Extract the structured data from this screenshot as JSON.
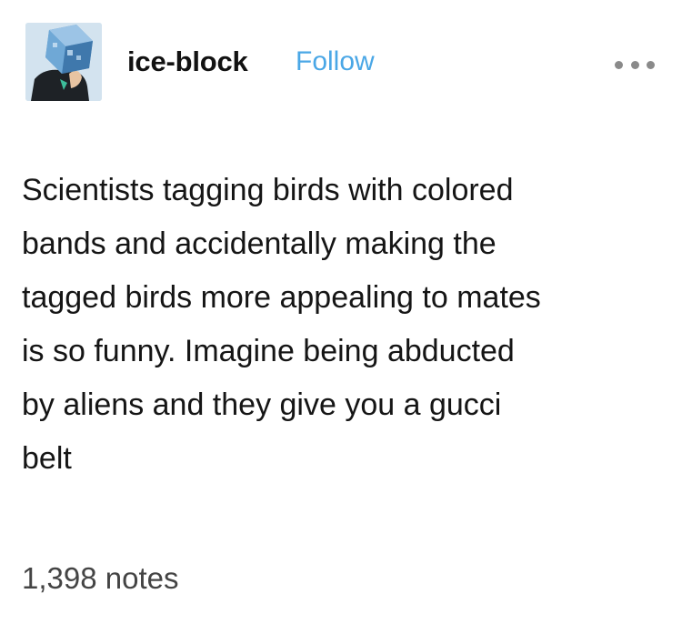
{
  "post": {
    "author": {
      "avatar_icon": "avatar-ice-block-head-icon",
      "username": "ice-block",
      "follow_label": "Follow"
    },
    "menu_icon": "more-options-icon",
    "body_lines": [
      "Scientists tagging birds with colored",
      "bands and accidentally making the",
      "tagged birds more appealing to mates",
      "is so funny. Imagine being abducted",
      "by aliens and they give you a gucci",
      "belt"
    ],
    "notes": "1,398 notes"
  },
  "colors": {
    "background": "#ffffff",
    "text": "#151515",
    "follow_link": "#4aa7e6",
    "notes_text": "#444444",
    "menu_dots": "#8a8a8a"
  }
}
